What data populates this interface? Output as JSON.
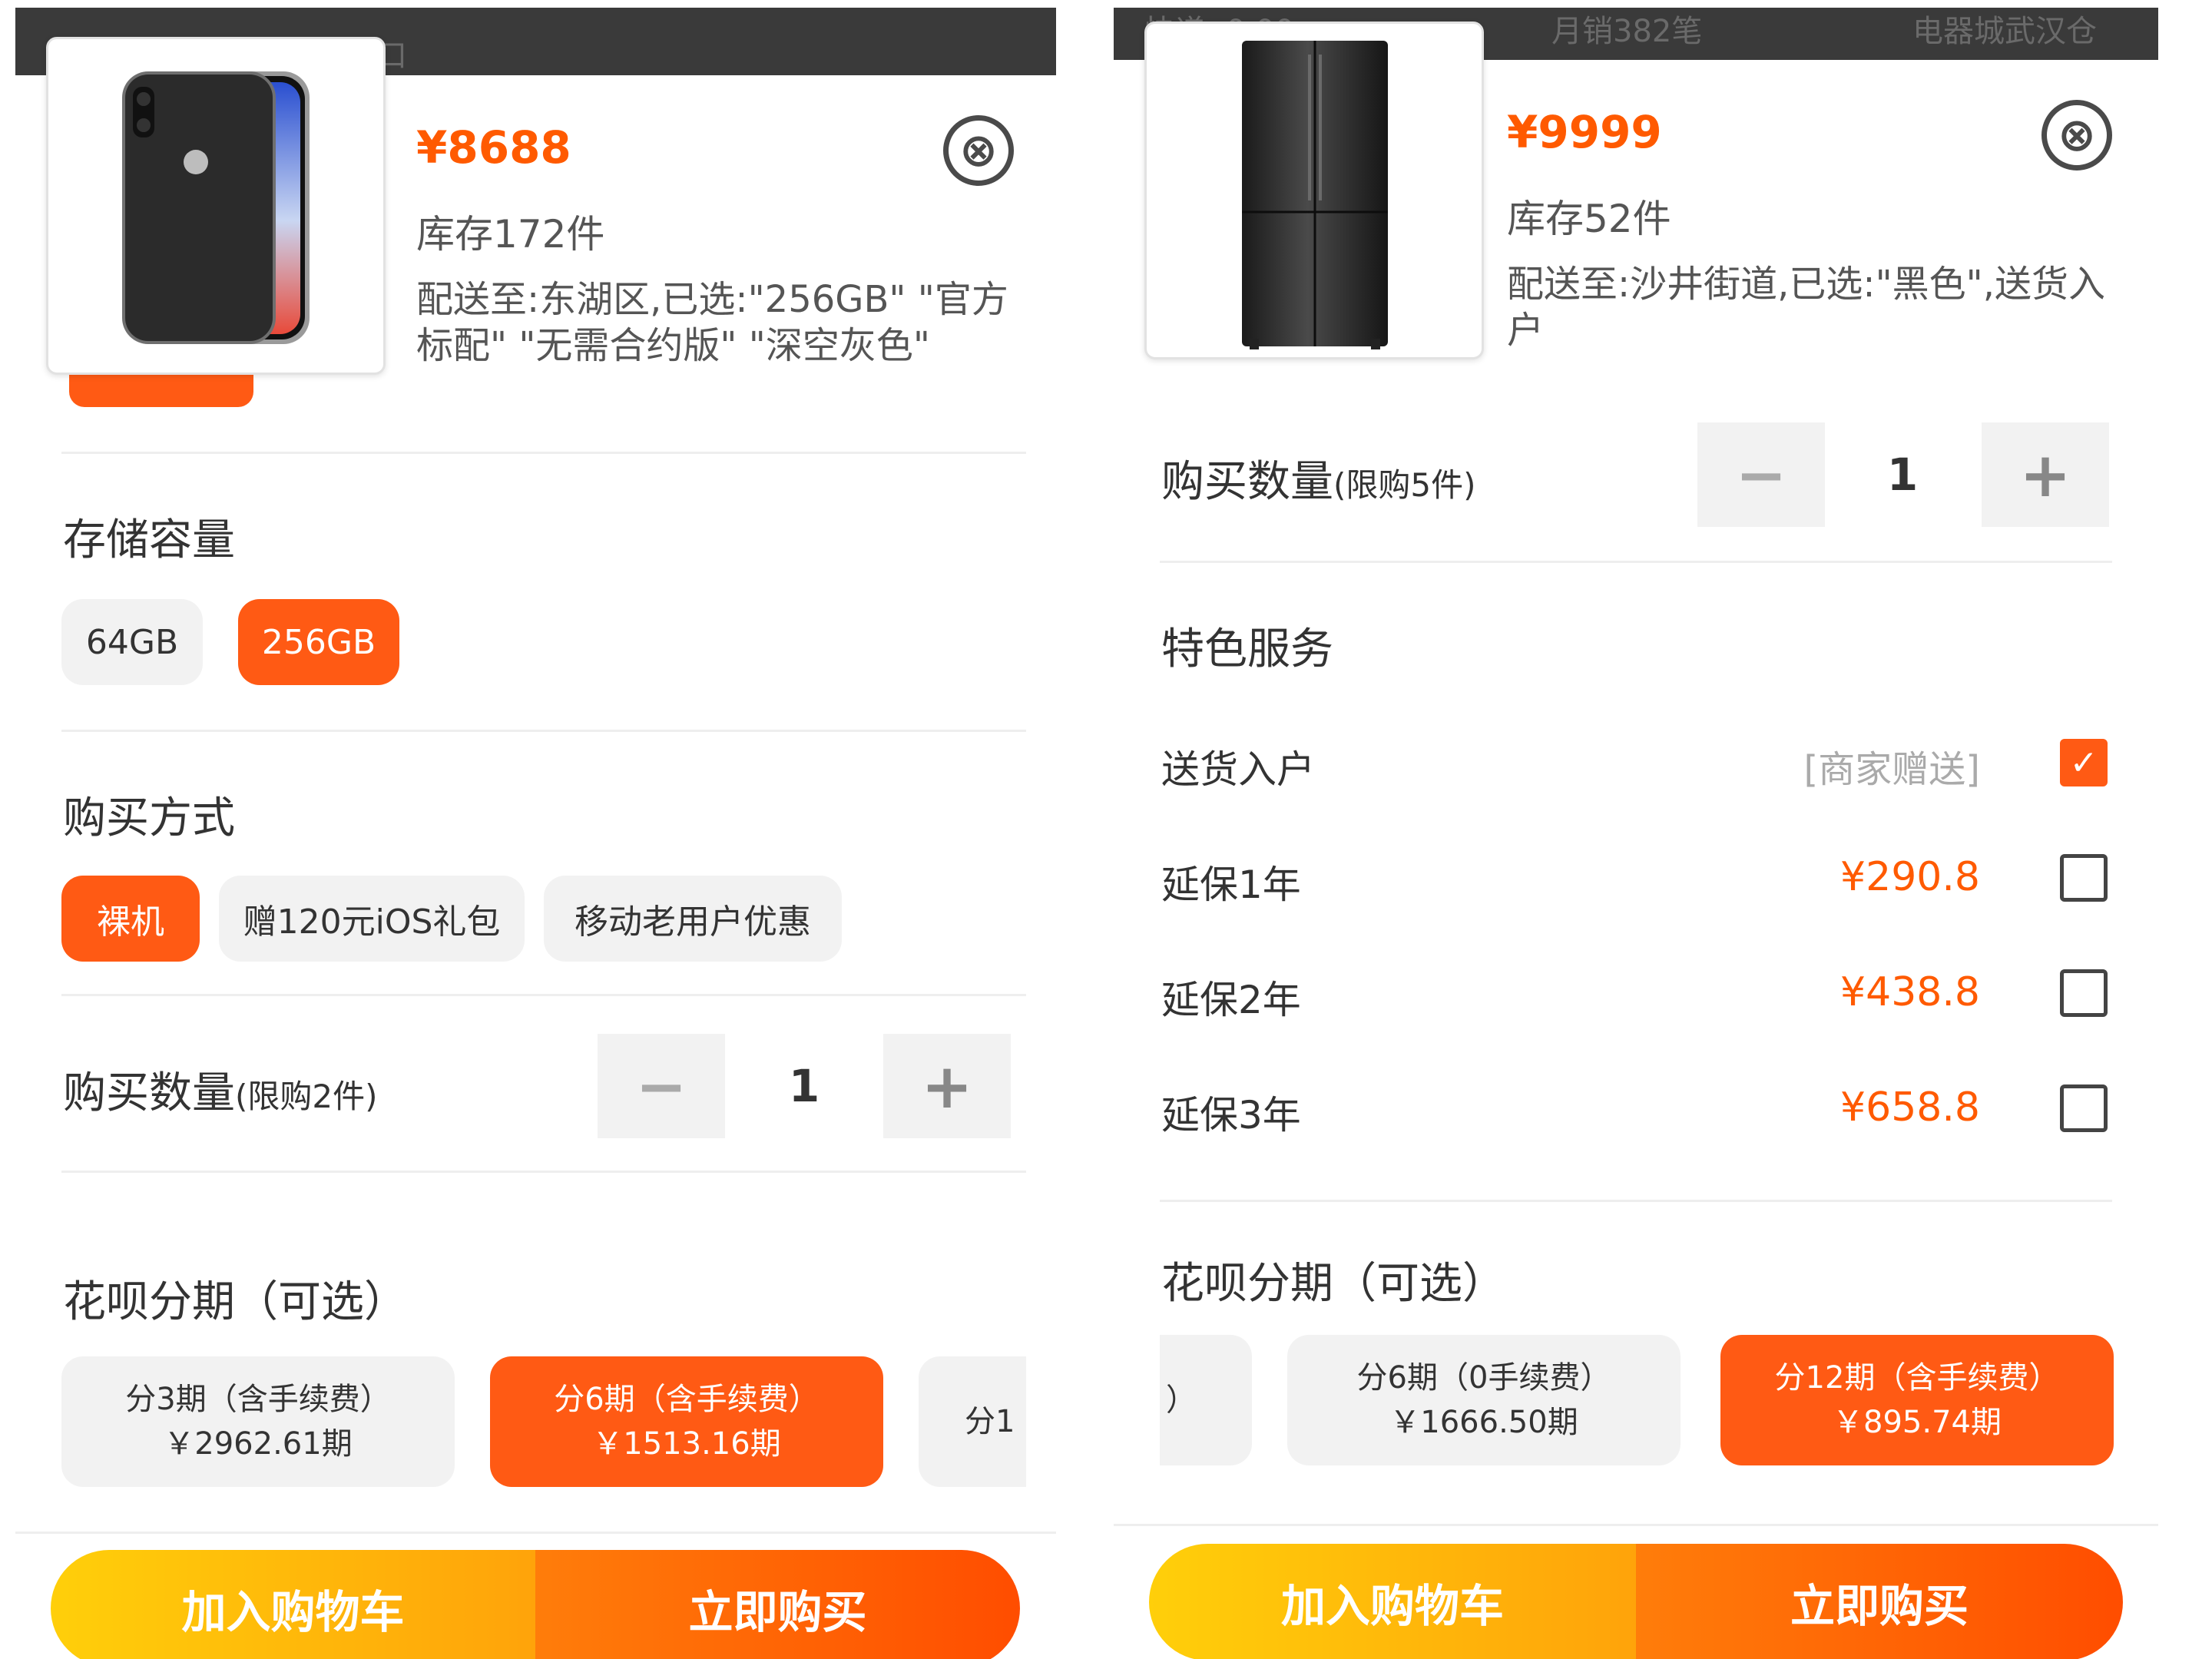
{
  "left": {
    "topbar_text": "口",
    "price": "¥8688",
    "stock": "库存172件",
    "ship_to_line1": "配送至:东湖区,已选:\"256GB\" \"官方",
    "ship_to_line2": "标配\" \"无需合约版\" \"深空灰色\"",
    "close_icon": "⊗",
    "storage": {
      "title": "存储容量",
      "options": [
        "64GB",
        "256GB"
      ],
      "selected": "256GB"
    },
    "purchase_method": {
      "title": "购买方式",
      "options": [
        "裸机",
        "赠120元iOS礼包",
        "移动老用户优惠"
      ],
      "selected": "裸机"
    },
    "quantity": {
      "title": "购买数量",
      "limit": "(限购2件)",
      "minus": "−",
      "value": "1",
      "plus": "+"
    },
    "installment": {
      "title": "花呗分期（可选）",
      "plans": [
        {
          "line1": "分3期（含手续费）",
          "line2": "￥2962.61期"
        },
        {
          "line1": "分6期（含手续费）",
          "line2": "￥1513.16期"
        },
        {
          "line1": "分1",
          "line2": ""
        }
      ],
      "selected_index": 1
    },
    "add_to_cart": "加入购物车",
    "buy_now": "立即购买"
  },
  "right": {
    "topbar_items": [
      "快递: 0.00",
      "月销382笔",
      "电器城武汉仓"
    ],
    "price": "¥9999",
    "stock": "库存52件",
    "ship_to_line1": "配送至:沙井街道,已选:\"黑色\",送货入",
    "ship_to_line2": "户",
    "close_icon": "⊗",
    "quantity": {
      "title": "购买数量",
      "limit": "(限购5件)",
      "minus": "−",
      "value": "1",
      "plus": "+"
    },
    "services": {
      "title": "特色服务",
      "items": [
        {
          "label": "送货入户",
          "price": "[商家赠送]",
          "checked": true
        },
        {
          "label": "延保1年",
          "price": "¥290.8",
          "checked": false
        },
        {
          "label": "延保2年",
          "price": "¥438.8",
          "checked": false
        },
        {
          "label": "延保3年",
          "price": "¥658.8",
          "checked": false
        }
      ],
      "check_mark": "✓"
    },
    "installment": {
      "title": "花呗分期（可选）",
      "plans": [
        {
          "line1": "）",
          "line2": ""
        },
        {
          "line1": "分6期（0手续费）",
          "line2": "￥1666.50期"
        },
        {
          "line1": "分12期（含手续费）",
          "line2": "￥895.74期"
        }
      ],
      "selected_index": 2
    },
    "add_to_cart": "加入购物车",
    "buy_now": "立即购买"
  },
  "colors": {
    "accent": "#ff5a14",
    "price": "#ff5a00",
    "cart_gradient_start": "#ffcf0a",
    "buy_gradient_end": "#ff4d00"
  }
}
